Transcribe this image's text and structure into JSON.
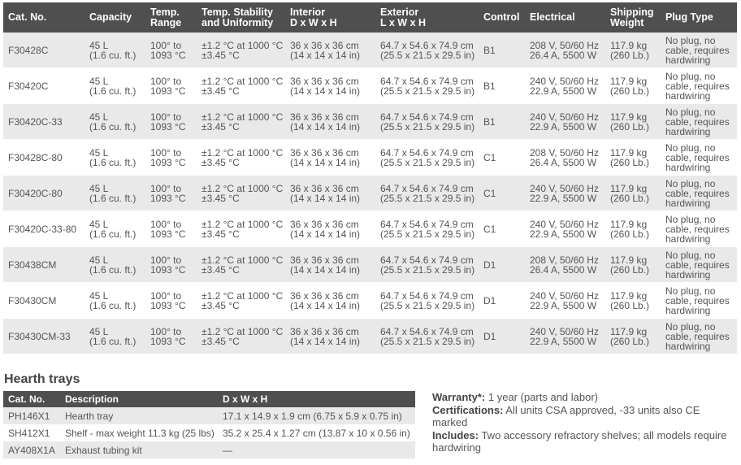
{
  "main_table": {
    "headers": [
      "Cat. No.",
      "Capacity",
      "Temp.\nRange",
      "Temp. Stability\nand Uniformity",
      "Interior\nD x W x H",
      "Exterior\nL x W x H",
      "Control",
      "Electrical",
      "Shipping\nWeight",
      "Plug Type"
    ],
    "rows": [
      [
        "F30428C",
        "45 L\n(1.6 cu. ft.)",
        "100° to\n1093 °C",
        "±1.2 °C at 1000 °C\n±3.45 °C",
        "36 x 36 x 36 cm\n(14 x 14 x 14 in)",
        "64.7 x 54.6 x 74.9 cm\n(25.5 x 21.5 x 29.5 in)",
        "B1",
        "208 V, 50/60 Hz\n26.4 A, 5500 W",
        "117.9 kg\n(260 Lb.)",
        "No plug, no\ncable, requires\nhardwiring"
      ],
      [
        "F30420C",
        "45 L\n(1.6 cu. ft.)",
        "100° to\n1093 °C",
        "±1.2 °C at 1000 °C\n±3.45 °C",
        "36 x 36 x 36 cm\n(14 x 14 x 14 in)",
        "64.7 x 54.6 x 74.9 cm\n(25.5 x 21.5 x 29.5 in)",
        "B1",
        "240 V, 50/60 Hz\n22.9 A, 5500 W",
        "117.9 kg\n(260 Lb.)",
        "No plug, no\ncable, requires\nhardwiring"
      ],
      [
        "F30420C-33",
        "45 L\n(1.6 cu. ft.)",
        "100° to\n1093 °C",
        "±1.2 °C at 1000 °C\n±3.45 °C",
        "36 x 36 x 36 cm\n(14 x 14 x 14 in)",
        "64.7 x 54.6 x 74.9 cm\n(25.5 x 21.5 x 29.5 in)",
        "B1",
        "240 V, 50/60 Hz\n22.9 A, 5500 W",
        "117.9 kg\n(260 Lb.)",
        "No plug, no\ncable, requires\nhardwiring"
      ],
      [
        "F30428C-80",
        "45 L\n(1.6 cu. ft.)",
        "100° to\n1093 °C",
        "±1.2 °C at 1000 °C\n±3.45 °C",
        "36 x 36 x 36 cm\n(14 x 14 x 14 in)",
        "64.7 x 54.6 x 74.9 cm\n(25.5 x 21.5 x 29.5 in)",
        "C1",
        "208 V, 50/60 Hz\n26.4 A, 5500 W",
        "117.9 kg\n(260 Lb.)",
        "No plug, no\ncable, requires\nhardwiring"
      ],
      [
        "F30420C-80",
        "45 L\n(1.6 cu. ft.)",
        "100° to\n1093 °C",
        "±1.2 °C at 1000 °C\n±3.45 °C",
        "36 x 36 x 36 cm\n(14 x 14 x 14 in)",
        "64.7 x 54.6 x 74.9 cm\n(25.5 x 21.5 x 29.5 in)",
        "C1",
        "240 V, 50/60 Hz\n22.9 A, 5500 W",
        "117.9 kg\n(260 Lb.)",
        "No plug, no\ncable, requires\nhardwiring"
      ],
      [
        "F30420C-33-80",
        "45 L\n(1.6 cu. ft.)",
        "100° to\n1093 °C",
        "±1.2 °C at 1000 °C\n±3.45 °C",
        "36 x 36 x 36 cm\n(14 x 14 x 14 in)",
        "64.7 x 54.6 x 74.9 cm\n(25.5 x 21.5 x 29.5 in)",
        "C1",
        "240 V, 50/60 Hz\n22.9 A, 5500 W",
        "117.9 kg\n(260 Lb.)",
        "No plug, no\ncable, requires\nhardwiring"
      ],
      [
        "F30438CM",
        "45 L\n(1.6 cu. ft.)",
        "100° to\n1093 °C",
        "±1.2 °C at 1000 °C\n±3.45 °C",
        "36 x 36 x 36 cm\n(14 x 14 x 14 in)",
        "64.7 x 54.6 x 74.9 cm\n(25.5 x 21.5 x 29.5 in)",
        "D1",
        "208 V, 50/60 Hz\n26.4 A, 5500 W",
        "117.9 kg\n(260 Lb.)",
        "No plug, no\ncable, requires\nhardwiring"
      ],
      [
        "F30430CM",
        "45 L\n(1.6 cu. ft.)",
        "100° to\n1093 °C",
        "±1.2 °C at 1000 °C\n±3.45 °C",
        "36 x 36 x 36 cm\n(14 x 14 x 14 in)",
        "64.7 x 54.6 x 74.9 cm\n(25.5 x 21.5 x 29.5 in)",
        "D1",
        "240 V, 50/60 Hz\n22.9 A, 5500 W",
        "117.9 kg\n(260 Lb.)",
        "No plug, no\ncable, requires\nhardwiring"
      ],
      [
        "F30430CM-33",
        "45 L\n(1.6 cu. ft.)",
        "100° to\n1093 °C",
        "±1.2 °C at 1000 °C\n±3.45 °C",
        "36 x 36 x 36 cm\n(14 x 14 x 14 in)",
        "64.7 x 54.6 x 74.9 cm\n(25.5 x 21.5 x 29.5 in)",
        "D1",
        "240 V, 50/60 Hz\n22.9 A, 5500 W",
        "117.9 kg\n(260 Lb.)",
        "No plug, no\ncable, requires\nhardwiring"
      ]
    ]
  },
  "hearth": {
    "title": "Hearth trays",
    "headers": [
      "Cat. No.",
      "Description",
      "D x W x H"
    ],
    "rows": [
      [
        "PH146X1",
        "Hearth tray",
        "17.1 x 14.9 x 1.9 cm (6.75 x 5.9 x 0.75 in)"
      ],
      [
        "SH412X1",
        "Shelf - max weight 11.3 kg (25 lbs)",
        "35.2 x 25.4 x 1.27 cm (13.87 x 10 x 0.56 in)"
      ],
      [
        "AY408X1A",
        "Exhaust tubing kit",
        "—"
      ]
    ]
  },
  "notes": {
    "warranty_label": "Warranty*:",
    "warranty_text": " 1 year (parts and labor)",
    "certifications_label": "Certifications:",
    "certifications_text": " All units CSA approved, -33 units also CE marked",
    "includes_label": "Includes:",
    "includes_text": " Two accessory refractory shelves; all models require hardwiring"
  },
  "colors": {
    "header_bg": "#4f4f4f",
    "stripe": "#e9e9e9",
    "text": "#555555"
  }
}
